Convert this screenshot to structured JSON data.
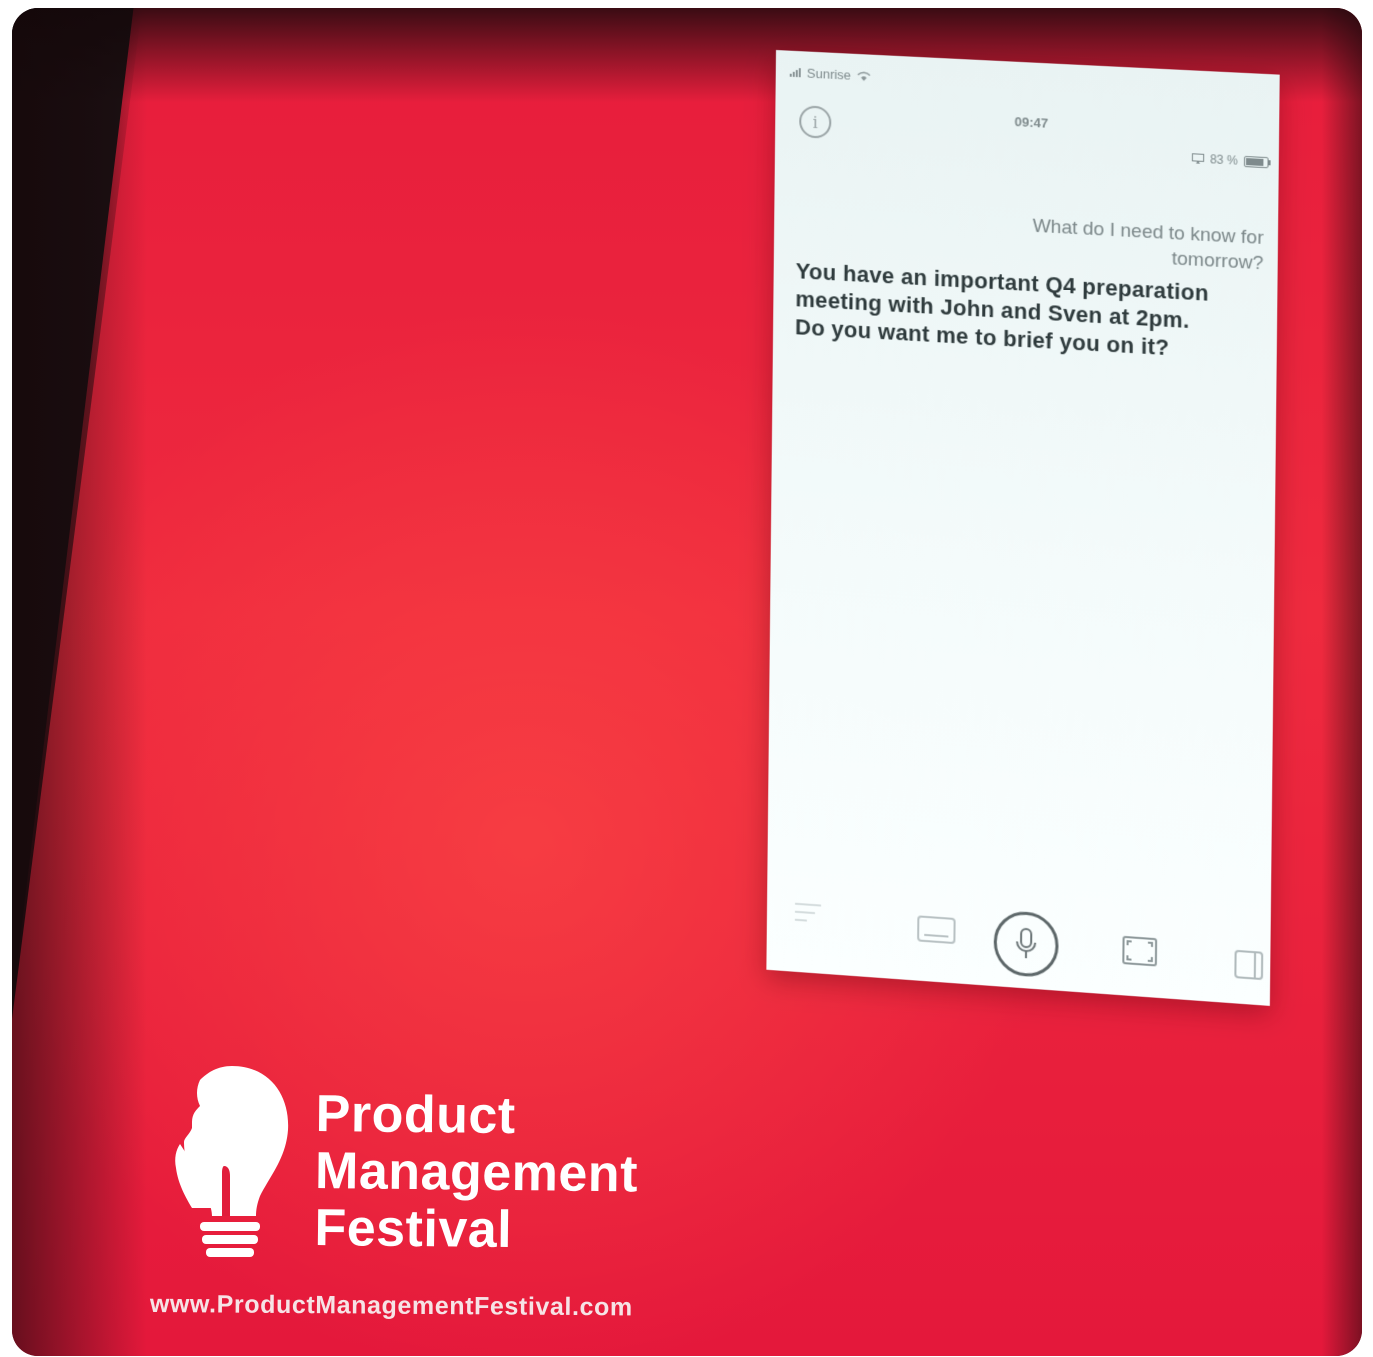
{
  "phone": {
    "status_bar": {
      "carrier": "Sunrise",
      "time": "09:47",
      "battery": "83 %"
    },
    "info_icon": "info-icon",
    "conversation": {
      "user_message": "What do I need to know for tomorrow?",
      "assistant_message": "You have an important Q4 preparation meeting with John and Sven at 2pm. Do you want me to brief you on it?"
    },
    "toolbar": {
      "icons": [
        "menu-lines-icon",
        "keyboard-icon",
        "microphone-icon",
        "expand-icon",
        "panel-icon"
      ]
    }
  },
  "branding": {
    "logo_icon": "lightbulb-face-icon",
    "name_line_1": "Product",
    "name_line_2": "Management",
    "name_line_3": "Festival",
    "url": "www.ProductManagementFestival.com"
  },
  "colors": {
    "slide_background": "#e61c3c",
    "phone_background": "#f1f9f9",
    "text_dark": "#2f3b3d",
    "text_muted": "#7b8789",
    "logo_white": "#ffffff"
  }
}
